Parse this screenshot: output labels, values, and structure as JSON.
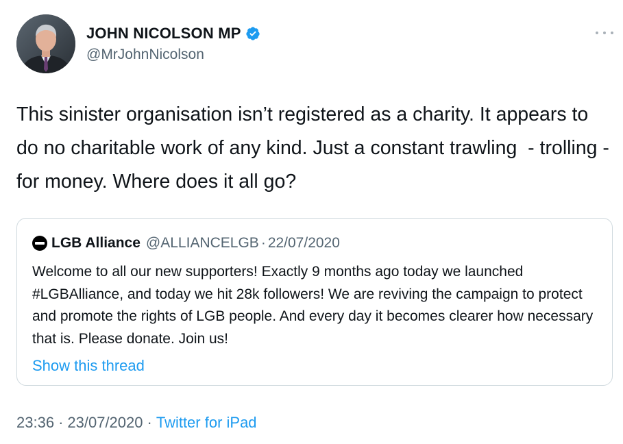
{
  "author": {
    "display_name": "JOHN NICOLSON MP",
    "handle": "@MrJohnNicolson",
    "verified": true,
    "avatar_icon": "profile-photo"
  },
  "tweet": {
    "text": "This sinister organisation isn’t registered as a charity. It appears to do no charitable work of any kind. Just a constant trawling  - trolling - for money. Where does it all go?"
  },
  "quoted_tweet": {
    "display_name": "LGB Alliance",
    "handle": "@ALLIANCELGB",
    "separator": "·",
    "date": "22/07/2020",
    "text": "Welcome to all our new supporters! Exactly 9 months ago today we launched #LGBAlliance, and today we hit 28k followers! We are reviving the campaign to protect and promote the rights of LGB people. And every day it becomes clearer how necessary that is. Please donate. Join us!",
    "show_thread_label": "Show this thread",
    "logo_icon": "lgb-alliance-logo"
  },
  "meta": {
    "time": "23:36",
    "separator": "·",
    "date": "23/07/2020",
    "source": "Twitter for iPad"
  },
  "colors": {
    "link": "#1d9bf0",
    "secondary_text": "#536471",
    "verified_badge": "#1d9bf0",
    "border": "#cfd9de"
  },
  "icons": {
    "verified": "verified-badge-icon",
    "more": "more-options-icon"
  }
}
